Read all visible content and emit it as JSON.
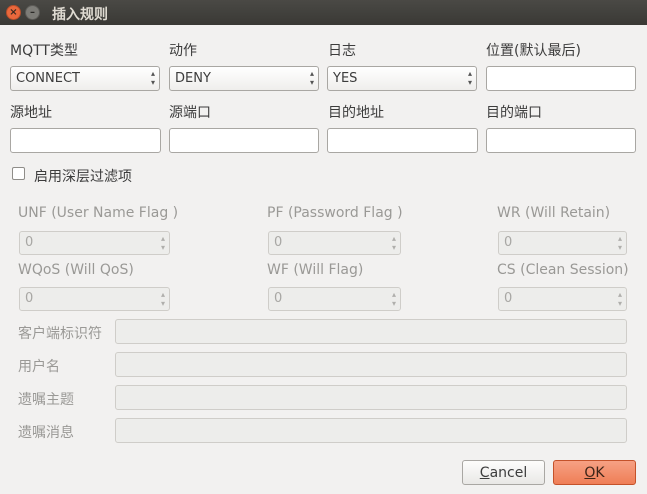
{
  "window": {
    "title": "插入规则",
    "close_glyph": "×",
    "minimize_glyph": "–"
  },
  "row1": {
    "mqtt_type_label": "MQTT类型",
    "mqtt_type_value": "CONNECT",
    "action_label": "动作",
    "action_value": "DENY",
    "log_label": "日志",
    "log_value": "YES",
    "position_label": "位置(默认最后)",
    "position_value": ""
  },
  "row2": {
    "src_addr_label": "源地址",
    "src_addr_value": "",
    "src_port_label": "源端口",
    "src_port_value": "",
    "dst_addr_label": "目的地址",
    "dst_addr_value": "",
    "dst_port_label": "目的端口",
    "dst_port_value": ""
  },
  "deep_filter": {
    "label": "启用深层过滤项",
    "checked": false
  },
  "flags": {
    "unf_label": "UNF (User Name Flag )",
    "unf_value": "0",
    "pf_label": "PF (Password Flag )",
    "pf_value": "0",
    "wr_label": "WR (Will Retain)",
    "wr_value": "0",
    "wqos_label": "WQoS (Will QoS)",
    "wqos_value": "0",
    "wf_label": "WF (Will Flag)",
    "wf_value": "0",
    "cs_label": "CS (Clean Session)",
    "cs_value": "0"
  },
  "deep_fields": {
    "client_id_label": "客户端标识符",
    "client_id_value": "",
    "username_label": "用户名",
    "username_value": "",
    "will_topic_label": "遗嘱主题",
    "will_topic_value": "",
    "will_message_label": "遗嘱消息",
    "will_message_value": ""
  },
  "buttons": {
    "cancel_mnemonic": "C",
    "cancel_rest": "ancel",
    "ok_mnemonic": "O",
    "ok_rest": "K"
  },
  "glyphs": {
    "spin_up": "▴",
    "spin_down": "▾"
  }
}
